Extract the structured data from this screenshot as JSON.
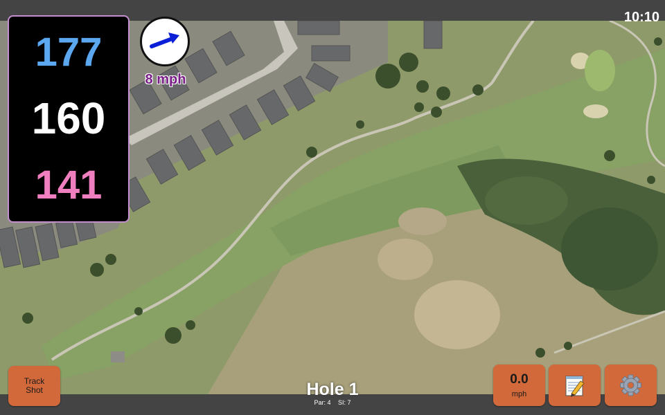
{
  "status": {
    "time": "10:10"
  },
  "distances": {
    "back": "177",
    "middle": "160",
    "front": "141"
  },
  "wind": {
    "speed": "8 mph",
    "direction_icon": "arrow-right-up-icon"
  },
  "buttons": {
    "track_shot": "Track\nShot",
    "speed_value": "0.0",
    "speed_unit": "mph",
    "notes_icon": "notepad-icon",
    "settings_icon": "gear-icon"
  },
  "hole": {
    "title": "Hole 1",
    "par": "Par: 4",
    "si": "SI: 7"
  },
  "colors": {
    "back_distance": "#5ba7f0",
    "middle_distance": "#ffffff",
    "front_distance": "#f07fbf",
    "button_orange": "#d2693a",
    "wind_text": "#7a1c88"
  }
}
